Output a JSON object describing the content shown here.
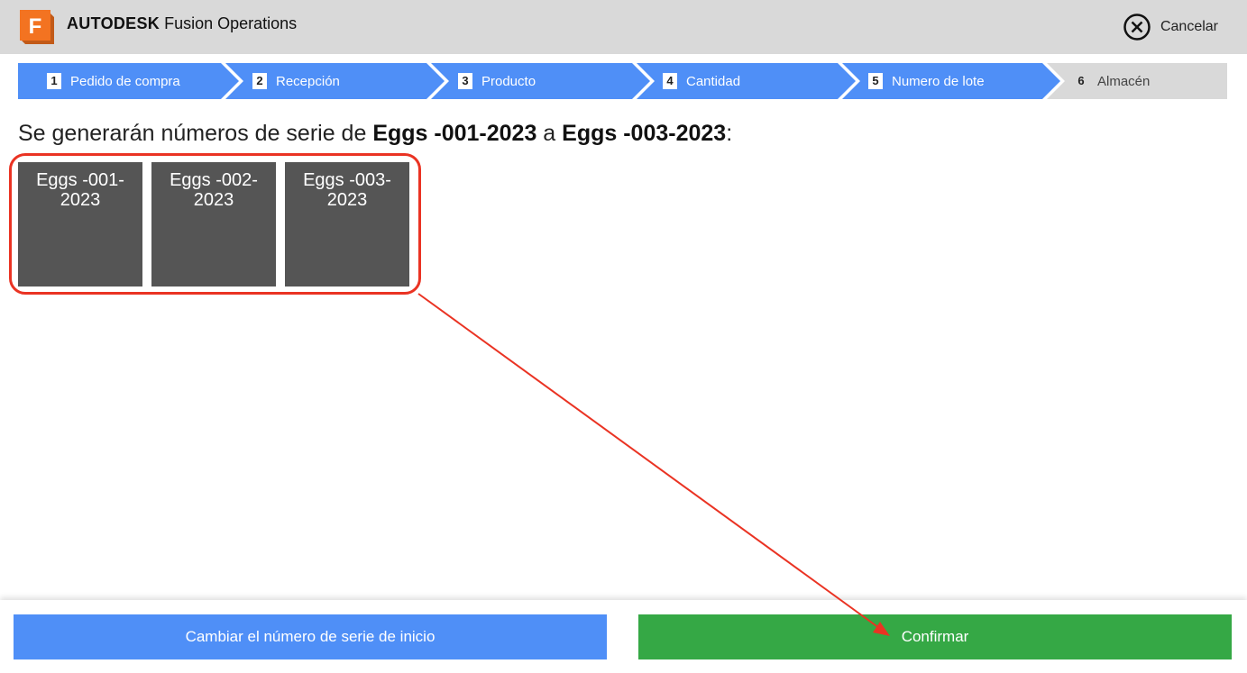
{
  "header": {
    "logo_letter": "F",
    "brand_bold": "AUTODESK",
    "brand_rest": "Fusion Operations",
    "cancel_label": "Cancelar",
    "cancel_icon": "close-circle-icon"
  },
  "steps": [
    {
      "num": "1",
      "label": "Pedido de compra",
      "active": true
    },
    {
      "num": "2",
      "label": "Recepción",
      "active": true
    },
    {
      "num": "3",
      "label": "Producto",
      "active": true
    },
    {
      "num": "4",
      "label": "Cantidad",
      "active": true
    },
    {
      "num": "5",
      "label": "Numero de lote",
      "active": true
    },
    {
      "num": "6",
      "label": "Almacén",
      "active": false
    }
  ],
  "message": {
    "prefix": "Se generarán números de serie de ",
    "from": "Eggs -001-2023",
    "middle": " a ",
    "to": "Eggs -003-2023",
    "suffix": ":"
  },
  "serials": [
    {
      "line1": "Eggs -001-",
      "line2": "2023"
    },
    {
      "line1": "Eggs -002-",
      "line2": "2023"
    },
    {
      "line1": "Eggs -003-",
      "line2": "2023"
    }
  ],
  "footer": {
    "change_start_label": "Cambiar el número de serie de inicio",
    "confirm_label": "Confirmar"
  },
  "colors": {
    "step_active": "#4f8ff7",
    "step_inactive": "#d9d9d9",
    "confirm": "#35a845",
    "change": "#4f8ff7",
    "annotation": "#ea3323",
    "logo": "#f37321"
  }
}
